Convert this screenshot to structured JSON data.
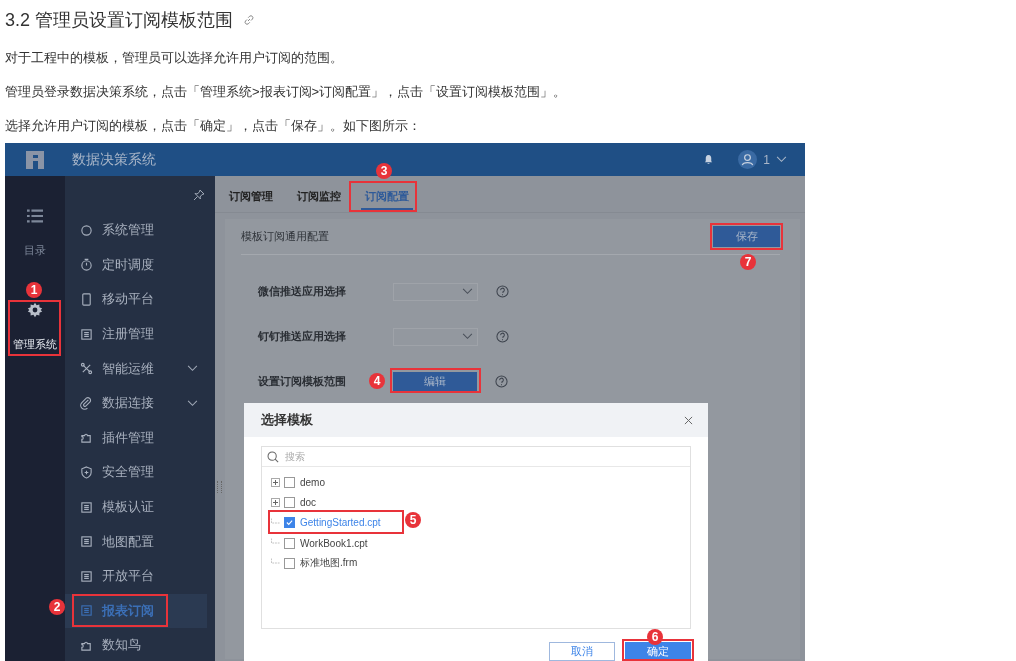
{
  "heading": {
    "title": "3.2 管理员设置订阅模板范围"
  },
  "paragraphs": [
    "对于工程中的模板，管理员可以选择允许用户订阅的范围。",
    "管理员登录数据决策系统，点击「管理系统>报表订阅>订阅配置」，点击「设置订阅模板范围」。",
    "选择允许用户订阅的模板，点击「确定」，点击「保存」。如下图所示："
  ],
  "screenshot": {
    "app_title": "数据决策系统",
    "user": "1",
    "rail": [
      {
        "label": "目录",
        "selected": false
      },
      {
        "label": "管理系统",
        "selected": true
      }
    ],
    "nav": [
      {
        "kind": "item",
        "label": "系统管理",
        "selected": false
      },
      {
        "kind": "item",
        "label": "定时调度",
        "selected": false
      },
      {
        "kind": "item",
        "label": "移动平台",
        "selected": false
      },
      {
        "kind": "item",
        "label": "注册管理",
        "selected": false
      },
      {
        "kind": "group",
        "label": "智能运维",
        "selected": false,
        "expanded": false
      },
      {
        "kind": "group",
        "label": "数据连接",
        "selected": false,
        "expanded": false
      },
      {
        "kind": "item",
        "label": "插件管理",
        "selected": false
      },
      {
        "kind": "item",
        "label": "安全管理",
        "selected": false
      },
      {
        "kind": "item",
        "label": "模板认证",
        "selected": false
      },
      {
        "kind": "item",
        "label": "地图配置",
        "selected": false
      },
      {
        "kind": "item",
        "label": "开放平台",
        "selected": false
      },
      {
        "kind": "item",
        "label": "报表订阅",
        "selected": true
      },
      {
        "kind": "item",
        "label": "数知鸟",
        "selected": false
      }
    ],
    "tabs": [
      {
        "label": "订阅管理",
        "selected": false
      },
      {
        "label": "订阅监控",
        "selected": false
      },
      {
        "label": "订阅配置",
        "selected": true
      }
    ],
    "panel": {
      "title": "模板订阅通用配置",
      "save_button": "保存",
      "fields": [
        {
          "kind": "select",
          "label": "微信推送应用选择"
        },
        {
          "kind": "select",
          "label": "钉钉推送应用选择"
        },
        {
          "kind": "button",
          "label": "设置订阅模板范围",
          "button": "编辑"
        }
      ]
    },
    "dialog": {
      "title": "选择模板",
      "search": {
        "placeholder": "搜索"
      },
      "tree": [
        {
          "kind": "folder",
          "label": "demo",
          "checked": false,
          "selected": false
        },
        {
          "kind": "folder",
          "label": "doc",
          "checked": false,
          "selected": false
        },
        {
          "kind": "file",
          "label": "GettingStarted.cpt",
          "checked": true,
          "selected": true
        },
        {
          "kind": "file",
          "label": "WorkBook1.cpt",
          "checked": false,
          "selected": false
        },
        {
          "kind": "file",
          "label": "标准地图.frm",
          "checked": false,
          "selected": false
        }
      ],
      "buttons": [
        "取消",
        "确定"
      ]
    },
    "annotations": [
      "1",
      "2",
      "3",
      "4",
      "5",
      "6",
      "7"
    ]
  }
}
